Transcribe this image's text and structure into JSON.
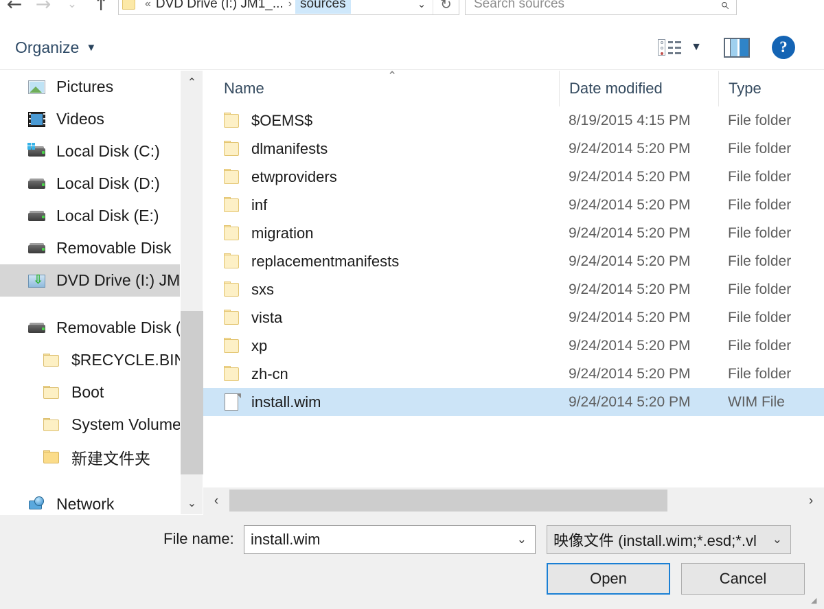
{
  "window": {
    "type": "file-open-dialog"
  },
  "navigation": {
    "back_label": "←",
    "forward_label": "→",
    "recent_label": "⌄",
    "up_label": "↑"
  },
  "address": {
    "overflow": "«",
    "crumb_drive": "DVD Drive (I:) JM1_...",
    "separator": "›",
    "crumb_current": "sources",
    "dropdown_glyph": "⌄",
    "refresh_glyph": "↻"
  },
  "search": {
    "placeholder": "Search sources",
    "icon_glyph": "⌕"
  },
  "toolbar": {
    "organize_label": "Organize",
    "organize_caret": "▼",
    "view_caret": "▼",
    "help_glyph": "?"
  },
  "sidebar": {
    "items": [
      {
        "label": "Pictures",
        "icon": "picture-icon",
        "indent": 1,
        "selected": false
      },
      {
        "label": "Videos",
        "icon": "video-icon",
        "indent": 1,
        "selected": false
      },
      {
        "label": "Local Disk (C:)",
        "icon": "drive-windows-icon",
        "indent": 1,
        "selected": false
      },
      {
        "label": "Local Disk (D:)",
        "icon": "drive-icon",
        "indent": 1,
        "selected": false
      },
      {
        "label": "Local Disk (E:)",
        "icon": "drive-icon",
        "indent": 1,
        "selected": false
      },
      {
        "label": "Removable Disk",
        "icon": "drive-icon",
        "indent": 1,
        "selected": false
      },
      {
        "label": "DVD Drive (I:) JM",
        "icon": "dvd-drive-icon",
        "indent": 1,
        "selected": true
      },
      {
        "label": "Removable Disk (F",
        "icon": "drive-icon",
        "indent": 1,
        "selected": false,
        "spacer_before": true
      },
      {
        "label": "$RECYCLE.BIN",
        "icon": "folder-icon",
        "indent": 2,
        "selected": false
      },
      {
        "label": "Boot",
        "icon": "folder-icon",
        "indent": 2,
        "selected": false
      },
      {
        "label": "System Volume I",
        "icon": "folder-icon",
        "indent": 2,
        "selected": false
      },
      {
        "label": "新建文件夹",
        "icon": "folder-icon-strong",
        "indent": 2,
        "selected": false
      },
      {
        "label": "Network",
        "icon": "network-icon",
        "indent": 1,
        "selected": false,
        "spacer_before": true
      }
    ],
    "scroll_up_glyph": "⌃",
    "scroll_down_glyph": "⌄"
  },
  "filelist": {
    "columns": [
      "Name",
      "Date modified",
      "Type"
    ],
    "sort_indicator": "⌃",
    "rows": [
      {
        "name": "$OEMS$",
        "date": "8/19/2015 4:15 PM",
        "type": "File folder",
        "icon": "folder-icon",
        "selected": false
      },
      {
        "name": "dlmanifests",
        "date": "9/24/2014 5:20 PM",
        "type": "File folder",
        "icon": "folder-icon",
        "selected": false
      },
      {
        "name": "etwproviders",
        "date": "9/24/2014 5:20 PM",
        "type": "File folder",
        "icon": "folder-icon",
        "selected": false
      },
      {
        "name": "inf",
        "date": "9/24/2014 5:20 PM",
        "type": "File folder",
        "icon": "folder-icon",
        "selected": false
      },
      {
        "name": "migration",
        "date": "9/24/2014 5:20 PM",
        "type": "File folder",
        "icon": "folder-icon",
        "selected": false
      },
      {
        "name": "replacementmanifests",
        "date": "9/24/2014 5:20 PM",
        "type": "File folder",
        "icon": "folder-icon",
        "selected": false
      },
      {
        "name": "sxs",
        "date": "9/24/2014 5:20 PM",
        "type": "File folder",
        "icon": "folder-icon",
        "selected": false
      },
      {
        "name": "vista",
        "date": "9/24/2014 5:20 PM",
        "type": "File folder",
        "icon": "folder-icon",
        "selected": false
      },
      {
        "name": "xp",
        "date": "9/24/2014 5:20 PM",
        "type": "File folder",
        "icon": "folder-icon",
        "selected": false
      },
      {
        "name": "zh-cn",
        "date": "9/24/2014 5:20 PM",
        "type": "File folder",
        "icon": "folder-icon",
        "selected": false
      },
      {
        "name": "install.wim",
        "date": "9/24/2014 5:20 PM",
        "type": "WIM File",
        "icon": "file-icon",
        "selected": true
      }
    ],
    "hscroll_left_glyph": "‹",
    "hscroll_right_glyph": "›"
  },
  "footer": {
    "filename_label": "File name:",
    "filename_value": "install.wim",
    "filename_caret": "⌄",
    "filter_value": "映像文件 (install.wim;*.esd;*.vl",
    "filter_caret": "⌄",
    "open_label": "Open",
    "cancel_label": "Cancel"
  },
  "colors": {
    "accent_blue": "#1a7fd4",
    "selection_blue": "#cce4f7",
    "crumb_highlight": "#cfe8fb",
    "sidebar_selection": "#d6d6d6",
    "panel_gray": "#f0f0f0",
    "scroll_thumb": "#cdcdcd",
    "folder_yellow": "#fdf0c6",
    "help_blue": "#1464b4"
  }
}
